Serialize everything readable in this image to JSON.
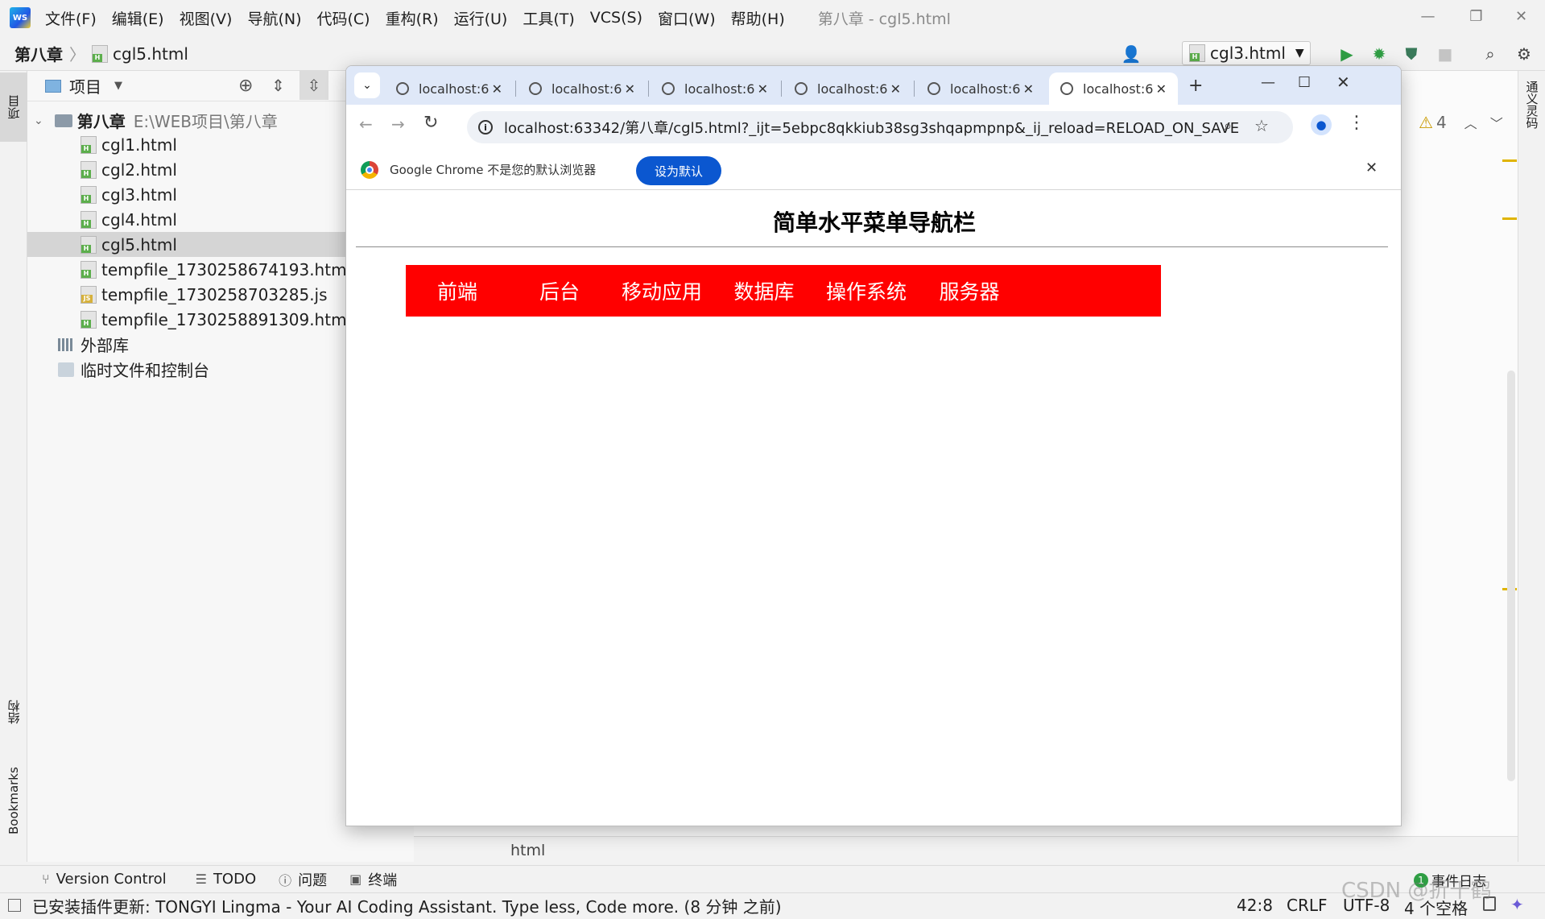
{
  "ide": {
    "logo_text": "WS",
    "menu": [
      "文件(F)",
      "编辑(E)",
      "视图(V)",
      "导航(N)",
      "代码(C)",
      "重构(R)",
      "运行(U)",
      "工具(T)",
      "VCS(S)",
      "窗口(W)",
      "帮助(H)"
    ],
    "window_title": "第八章 - cgl5.html",
    "breadcrumb": {
      "project": "第八章",
      "file": "cgl5.html"
    },
    "run_config": "cgl3.html",
    "left_tabs": {
      "project": "项目",
      "structure": "结构",
      "bookmarks": "Bookmarks"
    },
    "right_tab": "通义灵码",
    "project_panel": {
      "title": "项目",
      "root_name": "第八章",
      "root_path": "E:\\WEB项目\\第八章",
      "files": [
        {
          "name": "cgl1.html",
          "type": "html"
        },
        {
          "name": "cgl2.html",
          "type": "html"
        },
        {
          "name": "cgl3.html",
          "type": "html"
        },
        {
          "name": "cgl4.html",
          "type": "html"
        },
        {
          "name": "cgl5.html",
          "type": "html",
          "selected": true
        },
        {
          "name": "tempfile_1730258674193.html",
          "type": "html"
        },
        {
          "name": "tempfile_1730258703285.js",
          "type": "js"
        },
        {
          "name": "tempfile_1730258891309.html",
          "type": "html"
        }
      ],
      "external_libs": "外部库",
      "scratches": "临时文件和控制台"
    },
    "warnings": {
      "count": "4"
    },
    "editor_breadcrumb": "html",
    "bottom_tools": [
      "Version Control",
      "TODO",
      "问题",
      "终端"
    ],
    "event_log": {
      "badge": "1",
      "label": "事件日志"
    },
    "status": {
      "message": "已安装插件更新: TONGYI Lingma - Your AI Coding Assistant. Type less, Code more. (8 分钟 之前)",
      "position": "42:8",
      "line_ending": "CRLF",
      "encoding": "UTF-8",
      "indent": "4 个空格"
    },
    "watermark": "CSDN @折千鹤"
  },
  "chrome": {
    "tabs": [
      {
        "label": "localhost:6"
      },
      {
        "label": "localhost:6"
      },
      {
        "label": "localhost:6"
      },
      {
        "label": "localhost:6"
      },
      {
        "label": "localhost:6"
      },
      {
        "label": "localhost:6",
        "active": true
      }
    ],
    "url": "localhost:63342/第八章/cgl5.html?_ijt=5ebpc8qkkiub38sg3shqapmpnp&_ij_reload=RELOAD_ON_SAVE",
    "infobar": {
      "text": "Google Chrome 不是您的默认浏览器",
      "button": "设为默认"
    },
    "page": {
      "title": "简单水平菜单导航栏",
      "menu_color": "#ff0000",
      "menu": [
        "前端",
        "后台",
        "移动应用",
        "数据库",
        "操作系统",
        "服务器"
      ]
    }
  }
}
